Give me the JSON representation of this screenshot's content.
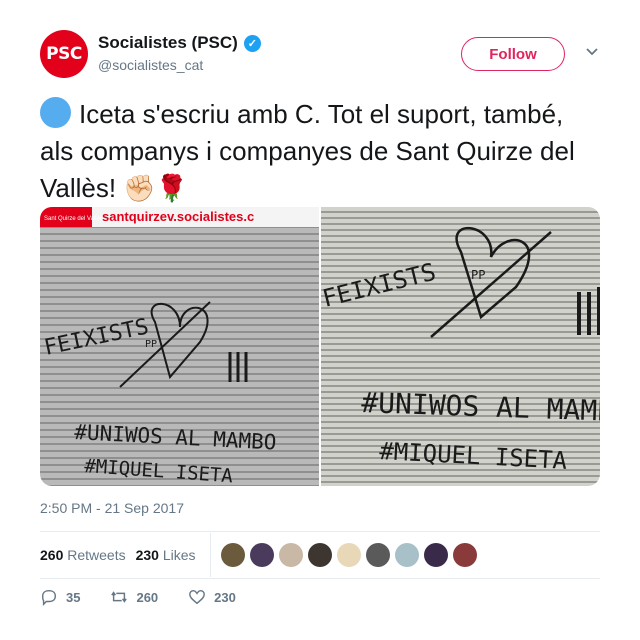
{
  "account": {
    "avatar_text": "PSC",
    "display_name": "Socialistes (PSC)",
    "handle": "@socialistes_cat",
    "follow_label": "Follow"
  },
  "tweet": {
    "text": "Iceta s'escriu amb C. Tot el suport, també, als companys i companyes de Sant Quirze del Vallès!",
    "emoji": "✊🏻🌹",
    "timestamp": "2:50 PM - 21 Sep 2017"
  },
  "media": {
    "left_banner_text": "santquirzev.socialistes.c",
    "left_banner_logo_text": "Sant Quirze del Vallès",
    "graffiti_feixistes": "FEIXISTS",
    "graffiti_pp": "PP",
    "graffiti_line1": "#UNIWOS AL MAMBO",
    "graffiti_line2": "#MIQUEL ISETA"
  },
  "stats": {
    "retweets_count": "260",
    "retweets_label": "Retweets",
    "likes_count": "230",
    "likes_label": "Likes"
  },
  "actions": {
    "reply_count": "35",
    "retweet_count": "260",
    "like_count": "230"
  },
  "colors": {
    "brand_red": "#e2001a",
    "follow": "#e0245e",
    "verified": "#1da1f2"
  },
  "liker_avatar_colors": [
    "#6b5a3c",
    "#4a3b5c",
    "#c9b8a6",
    "#3d3530",
    "#e8d8b8",
    "#5a5a5a",
    "#a8c0c8",
    "#3a2a4a",
    "#8a3a3a"
  ]
}
